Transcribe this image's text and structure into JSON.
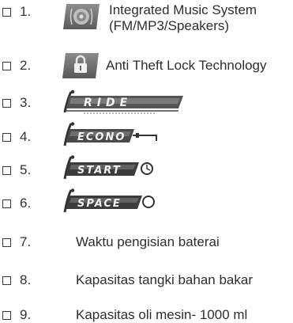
{
  "items": [
    {
      "number": "1.",
      "label_lines": [
        "Integrated Music System",
        "(FM/MP3/Speakers)"
      ],
      "icon": "music-system-icon"
    },
    {
      "number": "2.",
      "label": "Anti Theft Lock Technology",
      "icon": "padlock-icon"
    },
    {
      "number": "3.",
      "logo_text": "RIDE",
      "icon": "i-ride-logo"
    },
    {
      "number": "4.",
      "logo_text": "ECONO",
      "icon": "i-econo-logo"
    },
    {
      "number": "5.",
      "logo_text": "START",
      "icon": "i-start-logo"
    },
    {
      "number": "6.",
      "logo_text": "SPACE",
      "icon": "i-space-logo"
    },
    {
      "number": "7.",
      "label": "Waktu pengisian baterai"
    },
    {
      "number": "8.",
      "label": "Kapasitas tangki bahan bakar"
    },
    {
      "number": "9.",
      "label": "Kapasitas oli mesin- 1000 ml"
    }
  ]
}
